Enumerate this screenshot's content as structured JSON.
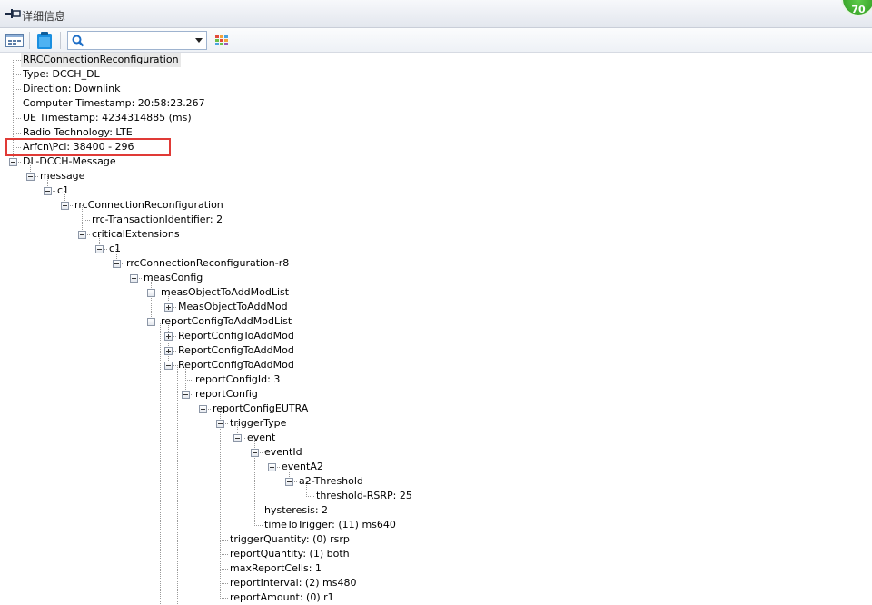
{
  "window": {
    "title": "详细信息",
    "badge": "70"
  },
  "toolbar": {
    "buttons": [
      {
        "icon": "layout-icon"
      },
      {
        "icon": "clipboard-icon"
      },
      {
        "icon": "color-grid-icon"
      }
    ],
    "search": {
      "value": "",
      "placeholder": ""
    }
  },
  "tree": {
    "nodes": [
      {
        "label": "RRCConnectionReconfiguration",
        "level": 0,
        "selected": true
      },
      {
        "label": "Type: DCCH_DL",
        "level": 0
      },
      {
        "label": "Direction: Downlink",
        "level": 0
      },
      {
        "label": "Computer Timestamp: 20:58:23.267",
        "level": 0
      },
      {
        "label": "UE Timestamp: 4234314885 (ms)",
        "level": 0
      },
      {
        "label": "Radio Technology: LTE",
        "level": 0
      },
      {
        "label": "Arfcn\\Pci: 38400 - 296",
        "level": 0,
        "highlighted": true
      },
      {
        "label": "DL-DCCH-Message",
        "level": 0,
        "toggle": "expanded"
      },
      {
        "label": "message",
        "level": 1,
        "toggle": "expanded"
      },
      {
        "label": "c1",
        "level": 2,
        "toggle": "expanded"
      },
      {
        "label": "rrcConnectionReconfiguration",
        "level": 3,
        "toggle": "expanded"
      },
      {
        "label": "rrc-TransactionIdentifier: 2",
        "level": 4
      },
      {
        "label": "criticalExtensions",
        "level": 4,
        "toggle": "expanded"
      },
      {
        "label": "c1",
        "level": 5,
        "toggle": "expanded"
      },
      {
        "label": "rrcConnectionReconfiguration-r8",
        "level": 6,
        "toggle": "expanded"
      },
      {
        "label": "measConfig",
        "level": 7,
        "toggle": "expanded"
      },
      {
        "label": "measObjectToAddModList",
        "level": 8,
        "toggle": "expanded"
      },
      {
        "label": "MeasObjectToAddMod",
        "level": 9,
        "toggle": "collapsed"
      },
      {
        "label": "reportConfigToAddModList",
        "level": 8,
        "toggle": "expanded"
      },
      {
        "label": "ReportConfigToAddMod",
        "level": 9,
        "toggle": "collapsed"
      },
      {
        "label": "ReportConfigToAddMod",
        "level": 9,
        "toggle": "collapsed"
      },
      {
        "label": "ReportConfigToAddMod",
        "level": 9,
        "toggle": "expanded"
      },
      {
        "label": "reportConfigId: 3",
        "level": 10
      },
      {
        "label": "reportConfig",
        "level": 10,
        "toggle": "expanded"
      },
      {
        "label": "reportConfigEUTRA",
        "level": 11,
        "toggle": "expanded"
      },
      {
        "label": "triggerType",
        "level": 12,
        "toggle": "expanded"
      },
      {
        "label": "event",
        "level": 13,
        "toggle": "expanded"
      },
      {
        "label": "eventId",
        "level": 14,
        "toggle": "expanded"
      },
      {
        "label": "eventA2",
        "level": 15,
        "toggle": "expanded"
      },
      {
        "label": "a2-Threshold",
        "level": 16,
        "toggle": "expanded"
      },
      {
        "label": "threshold-RSRP: 25",
        "level": 17
      },
      {
        "label": "hysteresis: 2",
        "level": 14
      },
      {
        "label": "timeToTrigger: (11) ms640",
        "level": 14
      },
      {
        "label": "triggerQuantity: (0) rsrp",
        "level": 12
      },
      {
        "label": "reportQuantity: (1) both",
        "level": 12
      },
      {
        "label": "maxReportCells: 1",
        "level": 12
      },
      {
        "label": "reportInterval: (2) ms480",
        "level": 12
      },
      {
        "label": "reportAmount: (0) r1",
        "level": 12
      }
    ]
  },
  "colors": {
    "highlight": "#e03a36",
    "tree_line": "#9a9a9a"
  }
}
